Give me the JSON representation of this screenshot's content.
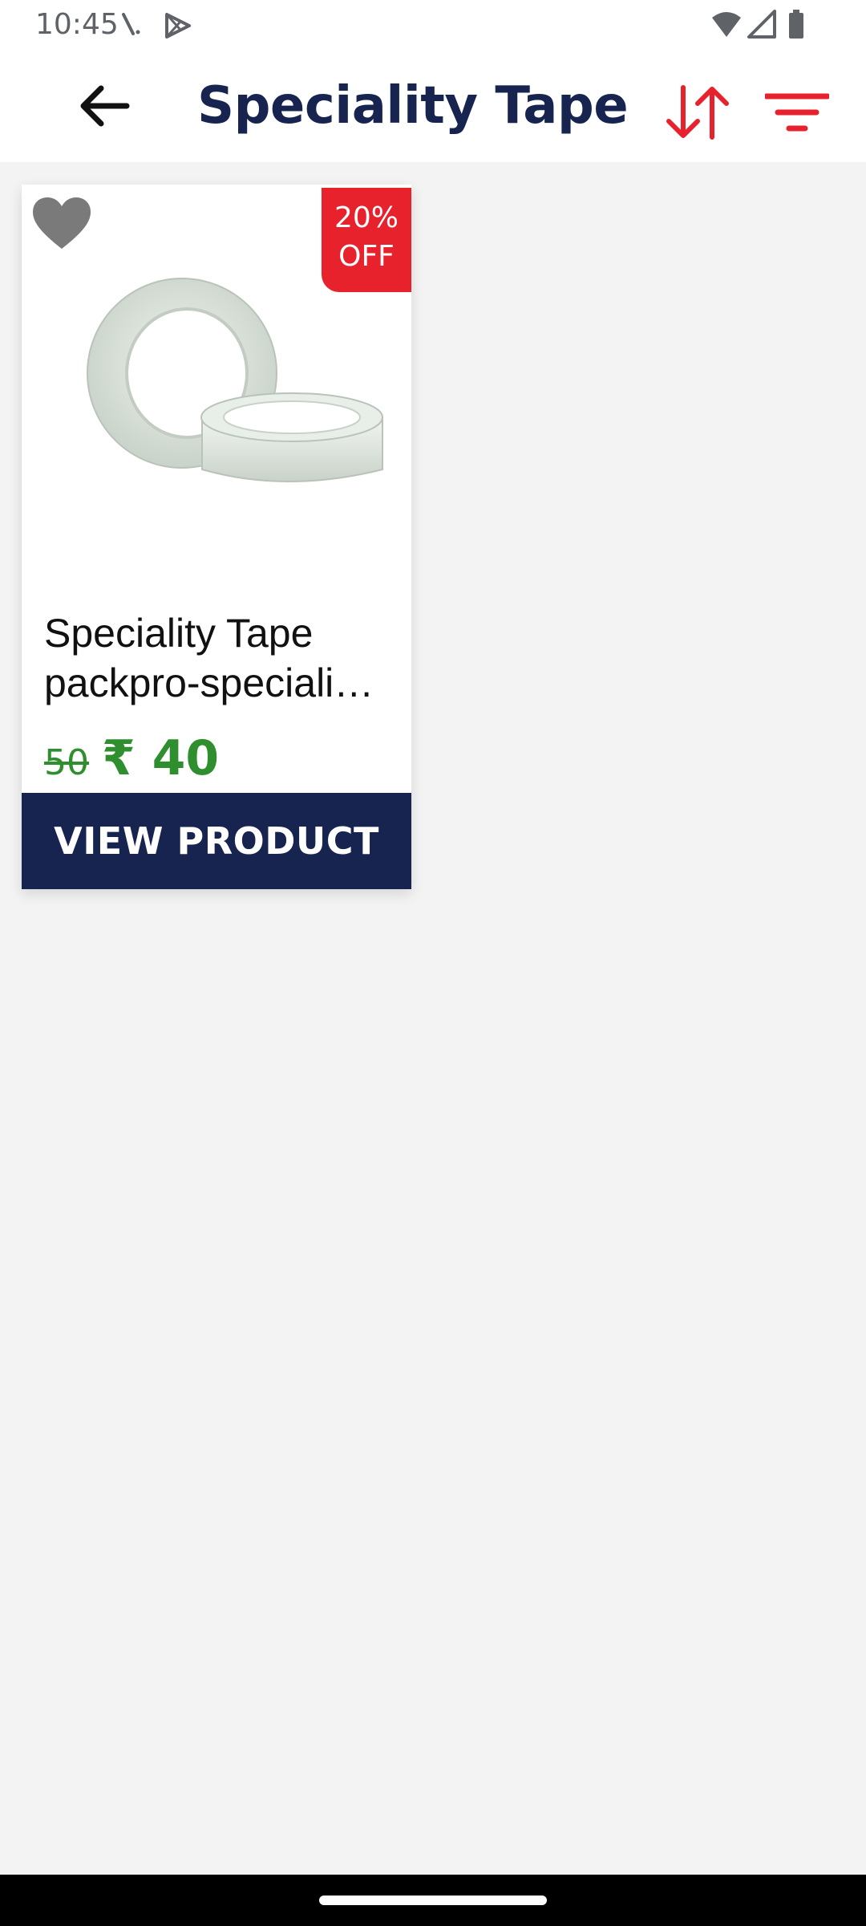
{
  "status_bar": {
    "time": "10:45",
    "left_icons": [
      "missed-call-icon",
      "play-store-icon"
    ],
    "right_icons": [
      "wifi-icon",
      "signal-icon",
      "battery-icon"
    ]
  },
  "app_bar": {
    "back_icon": "arrow-left-icon",
    "title": "Speciality Tape",
    "sort_icon": "sort-arrows-icon",
    "filter_icon": "filter-icon",
    "accent_color": "#e8222d",
    "title_color": "#16244f"
  },
  "products": [
    {
      "name_line1": "Speciality Tape",
      "name_line2": "packpro-speciali…",
      "old_price": "50",
      "new_price": "₹ 40",
      "discount_line1": "20%",
      "discount_line2": "OFF",
      "favorite_icon": "heart-icon",
      "image": "tape-rolls-image",
      "button_label": "VIEW PRODUCT",
      "price_color": "#2f8f2f",
      "button_color": "#16244f"
    }
  ]
}
